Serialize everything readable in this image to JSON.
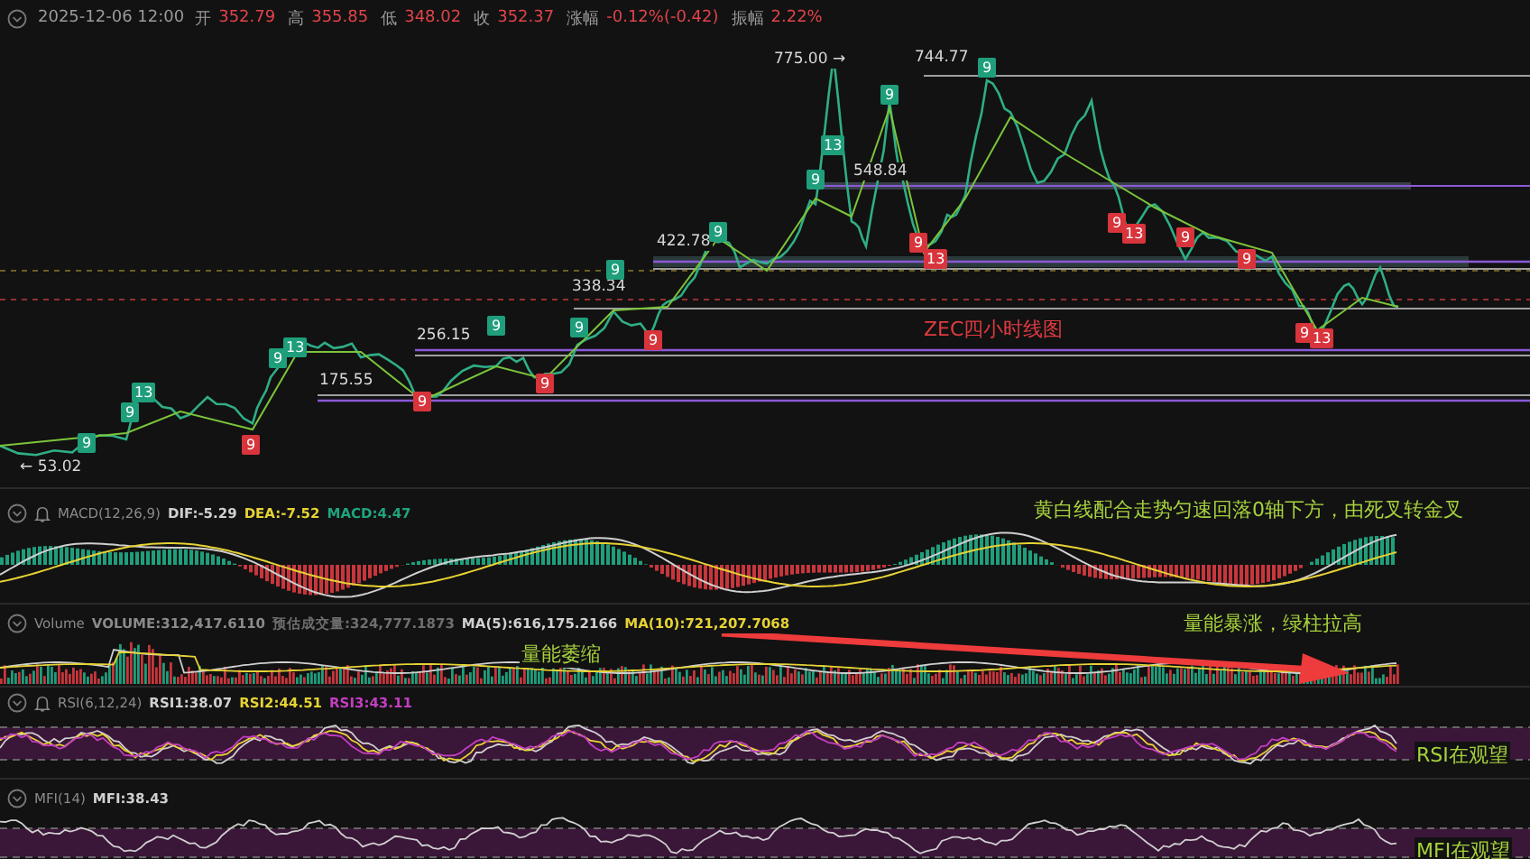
{
  "header": {
    "datetime": "2025-12-06 12:00",
    "fields": [
      {
        "label": "开",
        "value": "352.79"
      },
      {
        "label": "高",
        "value": "355.85"
      },
      {
        "label": "低",
        "value": "348.02"
      },
      {
        "label": "收",
        "value": "352.37"
      },
      {
        "label": "涨幅",
        "value": "-0.12%(-0.42)"
      },
      {
        "label": "振幅",
        "value": "2.22%"
      }
    ]
  },
  "main_chart": {
    "title": "ZEC四小时线图",
    "price_labels": [
      "775.00 →",
      "744.77",
      "548.84",
      "422.78",
      "338.34",
      "256.15",
      "175.55",
      "← 53.02"
    ],
    "markers": [
      {
        "label": "9",
        "color": "#1f9e7c"
      },
      {
        "label": "9",
        "color": "#1f9e7c"
      },
      {
        "label": "13",
        "color": "#1f9e7c"
      },
      {
        "label": "9",
        "color": "#d8343c"
      },
      {
        "label": "9",
        "color": "#1f9e7c"
      },
      {
        "label": "13",
        "color": "#1f9e7c"
      },
      {
        "label": "9",
        "color": "#d8343c"
      },
      {
        "label": "9",
        "color": "#1f9e7c"
      },
      {
        "label": "9",
        "color": "#d8343c"
      },
      {
        "label": "9",
        "color": "#1f9e7c"
      },
      {
        "label": "9",
        "color": "#1f9e7c"
      },
      {
        "label": "9",
        "color": "#d8343c"
      },
      {
        "label": "9",
        "color": "#1f9e7c"
      },
      {
        "label": "9",
        "color": "#1f9e7c"
      },
      {
        "label": "13",
        "color": "#1f9e7c"
      },
      {
        "label": "9",
        "color": "#1f9e7c"
      },
      {
        "label": "9",
        "color": "#d8343c"
      },
      {
        "label": "13",
        "color": "#d8343c"
      },
      {
        "label": "9",
        "color": "#1f9e7c"
      },
      {
        "label": "9",
        "color": "#d8343c"
      },
      {
        "label": "13",
        "color": "#d8343c"
      },
      {
        "label": "9",
        "color": "#d8343c"
      },
      {
        "label": "9",
        "color": "#d8343c"
      },
      {
        "label": "9",
        "color": "#d8343c"
      },
      {
        "label": "13",
        "color": "#d8343c"
      }
    ]
  },
  "panels": [
    {
      "kind": "macd",
      "name": "MACD(12,26,9)",
      "bell": true,
      "readings": [
        {
          "text": "DIF:-5.29",
          "color": "#d0d0d0"
        },
        {
          "text": "DEA:-7.52",
          "color": "#e6d234"
        },
        {
          "text": "MACD:4.47",
          "color": "#1fa37e"
        }
      ],
      "notes": [
        "黄白线配合走势匀速回落0轴下方，由死叉转金叉"
      ]
    },
    {
      "kind": "volume",
      "name": "Volume",
      "bell": false,
      "readings": [
        {
          "text": "VOLUME:312,417.6110",
          "color": "#8a8a8a"
        },
        {
          "text": "预估成交量:324,777.1873",
          "color": "#6e6e6e"
        },
        {
          "text": "MA(5):616,175.2166",
          "color": "#d0d0d0"
        },
        {
          "text": "MA(10):721,207.7068",
          "color": "#e6d234"
        }
      ],
      "notes": [
        "量能萎缩",
        "量能暴涨，绿柱拉高"
      ]
    },
    {
      "kind": "rsi",
      "name": "RSI(6,12,24)",
      "bell": true,
      "readings": [
        {
          "text": "RSI1:38.07",
          "color": "#d0d0d0"
        },
        {
          "text": "RSI2:44.51",
          "color": "#e6d234"
        },
        {
          "text": "RSI3:43.11",
          "color": "#c23ec0"
        }
      ],
      "notes": [
        "RSI在观望"
      ]
    },
    {
      "kind": "mfi",
      "name": "MFI(14)",
      "bell": false,
      "readings": [
        {
          "text": "MFI:38.43",
          "color": "#d0d0d0"
        }
      ],
      "notes": [
        "MFI在观望"
      ]
    }
  ]
}
